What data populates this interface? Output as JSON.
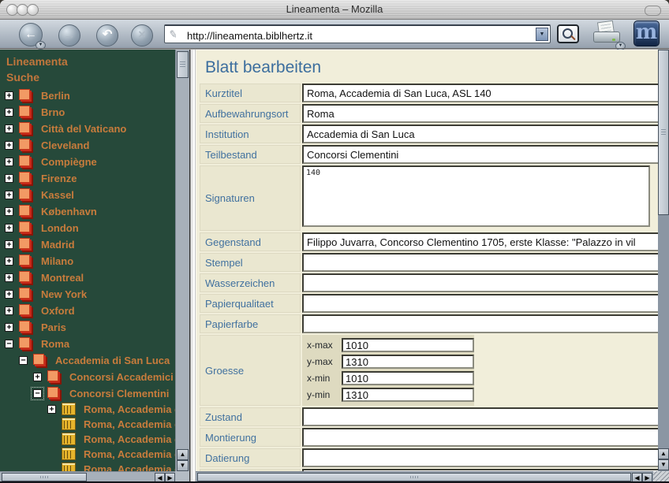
{
  "window": {
    "title": "Lineamenta – Mozilla"
  },
  "toolbar": {
    "url": "http://lineamenta.biblhertz.it",
    "back_glyph": "←",
    "forward_glyph": "→",
    "reload_glyph": "↶",
    "stop_glyph": "×",
    "logo_letter": "m"
  },
  "sidebar": {
    "links": [
      {
        "label": "Lineamenta"
      },
      {
        "label": "Suche"
      }
    ],
    "tree": [
      {
        "label": "Berlin",
        "level": 0,
        "expander": "plus",
        "icon": "collection"
      },
      {
        "label": "Brno",
        "level": 0,
        "expander": "plus",
        "icon": "collection"
      },
      {
        "label": "Città del Vaticano",
        "level": 0,
        "expander": "plus",
        "icon": "collection"
      },
      {
        "label": "Cleveland",
        "level": 0,
        "expander": "plus",
        "icon": "collection"
      },
      {
        "label": "Compiègne",
        "level": 0,
        "expander": "plus",
        "icon": "collection"
      },
      {
        "label": "Firenze",
        "level": 0,
        "expander": "plus",
        "icon": "collection"
      },
      {
        "label": "Kassel",
        "level": 0,
        "expander": "plus",
        "icon": "collection"
      },
      {
        "label": "København",
        "level": 0,
        "expander": "plus",
        "icon": "collection"
      },
      {
        "label": "London",
        "level": 0,
        "expander": "plus",
        "icon": "collection"
      },
      {
        "label": "Madrid",
        "level": 0,
        "expander": "plus",
        "icon": "collection"
      },
      {
        "label": "Milano",
        "level": 0,
        "expander": "plus",
        "icon": "collection"
      },
      {
        "label": "Montreal",
        "level": 0,
        "expander": "plus",
        "icon": "collection"
      },
      {
        "label": "New York",
        "level": 0,
        "expander": "plus",
        "icon": "collection"
      },
      {
        "label": "Oxford",
        "level": 0,
        "expander": "plus",
        "icon": "collection"
      },
      {
        "label": "Paris",
        "level": 0,
        "expander": "plus",
        "icon": "collection"
      },
      {
        "label": "Roma",
        "level": 0,
        "expander": "minus",
        "icon": "collection"
      },
      {
        "label": "Accademia di San Luca",
        "level": 1,
        "expander": "minus",
        "icon": "collection"
      },
      {
        "label": "Concorsi Accademici",
        "level": 2,
        "expander": "plus",
        "icon": "collection"
      },
      {
        "label": "Concorsi Clementini",
        "level": 2,
        "expander": "minus",
        "icon": "collection",
        "focused": true
      },
      {
        "label": "Roma, Accademia d",
        "level": 3,
        "expander": "plus",
        "icon": "leaf"
      },
      {
        "label": "Roma, Accademia d",
        "level": 3,
        "expander": "none",
        "icon": "leaf"
      },
      {
        "label": "Roma, Accademia d",
        "level": 3,
        "expander": "none",
        "icon": "leaf"
      },
      {
        "label": "Roma, Accademia d",
        "level": 3,
        "expander": "none",
        "icon": "leaf"
      },
      {
        "label": "Roma, Accademia d",
        "level": 3,
        "expander": "none",
        "icon": "leaf",
        "partial": true
      }
    ]
  },
  "form": {
    "title": "Blatt bearbeiten",
    "rows": [
      {
        "label": "Kurztitel",
        "type": "text",
        "value": "Roma, Accademia di San Luca, ASL 140"
      },
      {
        "label": "Aufbewahrungsort",
        "type": "text",
        "value": "Roma"
      },
      {
        "label": "Institution",
        "type": "text",
        "value": "Accademia di San Luca"
      },
      {
        "label": "Teilbestand",
        "type": "text",
        "value": "Concorsi Clementini"
      },
      {
        "label": "Signaturen",
        "type": "textarea",
        "value": "140"
      },
      {
        "label": "Gegenstand",
        "type": "text",
        "value": "Filippo Juvarra, Concorso Clementino 1705, erste Klasse: \"Palazzo in vil"
      },
      {
        "label": "Stempel",
        "type": "text",
        "value": ""
      },
      {
        "label": "Wasserzeichen",
        "type": "text",
        "value": ""
      },
      {
        "label": "Papierqualitaet",
        "type": "text",
        "value": ""
      },
      {
        "label": "Papierfarbe",
        "type": "text",
        "value": ""
      },
      {
        "label": "Groesse",
        "type": "size-group",
        "fields": [
          {
            "label": "x-max",
            "value": "1010"
          },
          {
            "label": "y-max",
            "value": "1310"
          },
          {
            "label": "x-min",
            "value": "1010"
          },
          {
            "label": "y-min",
            "value": "1310"
          }
        ]
      },
      {
        "label": "Zustand",
        "type": "text",
        "value": ""
      },
      {
        "label": "Montierung",
        "type": "text",
        "value": ""
      },
      {
        "label": "Datierung",
        "type": "text",
        "value": ""
      },
      {
        "label": "",
        "type": "text",
        "value": ""
      }
    ]
  },
  "colors": {
    "sidebar_bg": "#26493a",
    "sidebar_text": "#c87c3c",
    "accent_blue": "#3c6e9e",
    "pane_bg": "#f1eeda",
    "label_bg": "#eae7d0",
    "size_group_bg": "#dedac0"
  }
}
